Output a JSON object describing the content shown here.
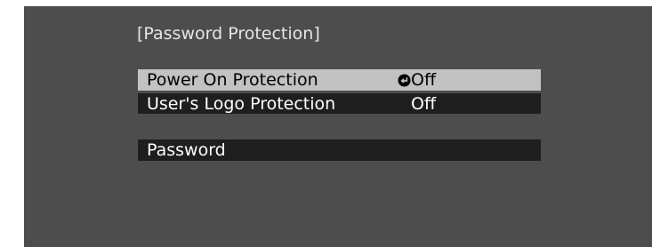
{
  "window": {
    "title": "[Password Protection]"
  },
  "menu": {
    "items": [
      {
        "label": "Power On Protection",
        "value": "Off",
        "selected": true,
        "icon": "enter-icon"
      },
      {
        "label": "User's Logo Protection",
        "value": "Off",
        "selected": false
      },
      {
        "label": "Password",
        "value": "",
        "selected": false
      }
    ]
  },
  "colors": {
    "screen_background": "#4d4d4d",
    "row_background": "#1e1e1e",
    "selected_row_background": "#c2c2c2",
    "text": "#ffffff",
    "selected_text": "#000000"
  }
}
